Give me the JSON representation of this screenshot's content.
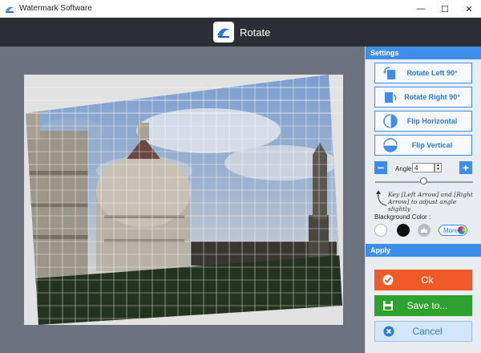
{
  "window": {
    "title": "Watermark Software",
    "controls": {
      "minimize": "—",
      "maximize": "☐",
      "close": "✕"
    }
  },
  "header": {
    "title": "Rotate",
    "icon": "rotate-app-icon"
  },
  "settings": {
    "section_title": "Settings",
    "buttons": [
      {
        "label": "Rotate Left 90°",
        "icon": "rotate-left-icon"
      },
      {
        "label": "Rotate Right 90°",
        "icon": "rotate-right-icon"
      },
      {
        "label": "Flip Horizontal",
        "icon": "flip-horizontal-icon"
      },
      {
        "label": "Flip Vertical",
        "icon": "flip-vertical-icon"
      }
    ],
    "angle": {
      "minus": "−",
      "label": "Angle:",
      "value": "4",
      "plus": "+",
      "slider_fraction": 0.5
    },
    "hint": "Key [Left Arrow] and [Right Arrow] to adjust angle slightly",
    "background": {
      "label": "Blackground Color :",
      "swatches": [
        "#ffffff",
        "#111111",
        "transparent"
      ],
      "more_label": "More"
    }
  },
  "apply": {
    "section_title": "Apply",
    "ok": {
      "label": "Ok",
      "color": "#f05a28"
    },
    "save": {
      "label": "Save to...",
      "color": "#2fa12f"
    },
    "cancel": {
      "label": "Cancel",
      "color": "#d4e6fb"
    }
  },
  "colors": {
    "accent": "#3d8ee8",
    "header_bg": "#2b2f35",
    "canvas_bg": "#6c737e"
  }
}
